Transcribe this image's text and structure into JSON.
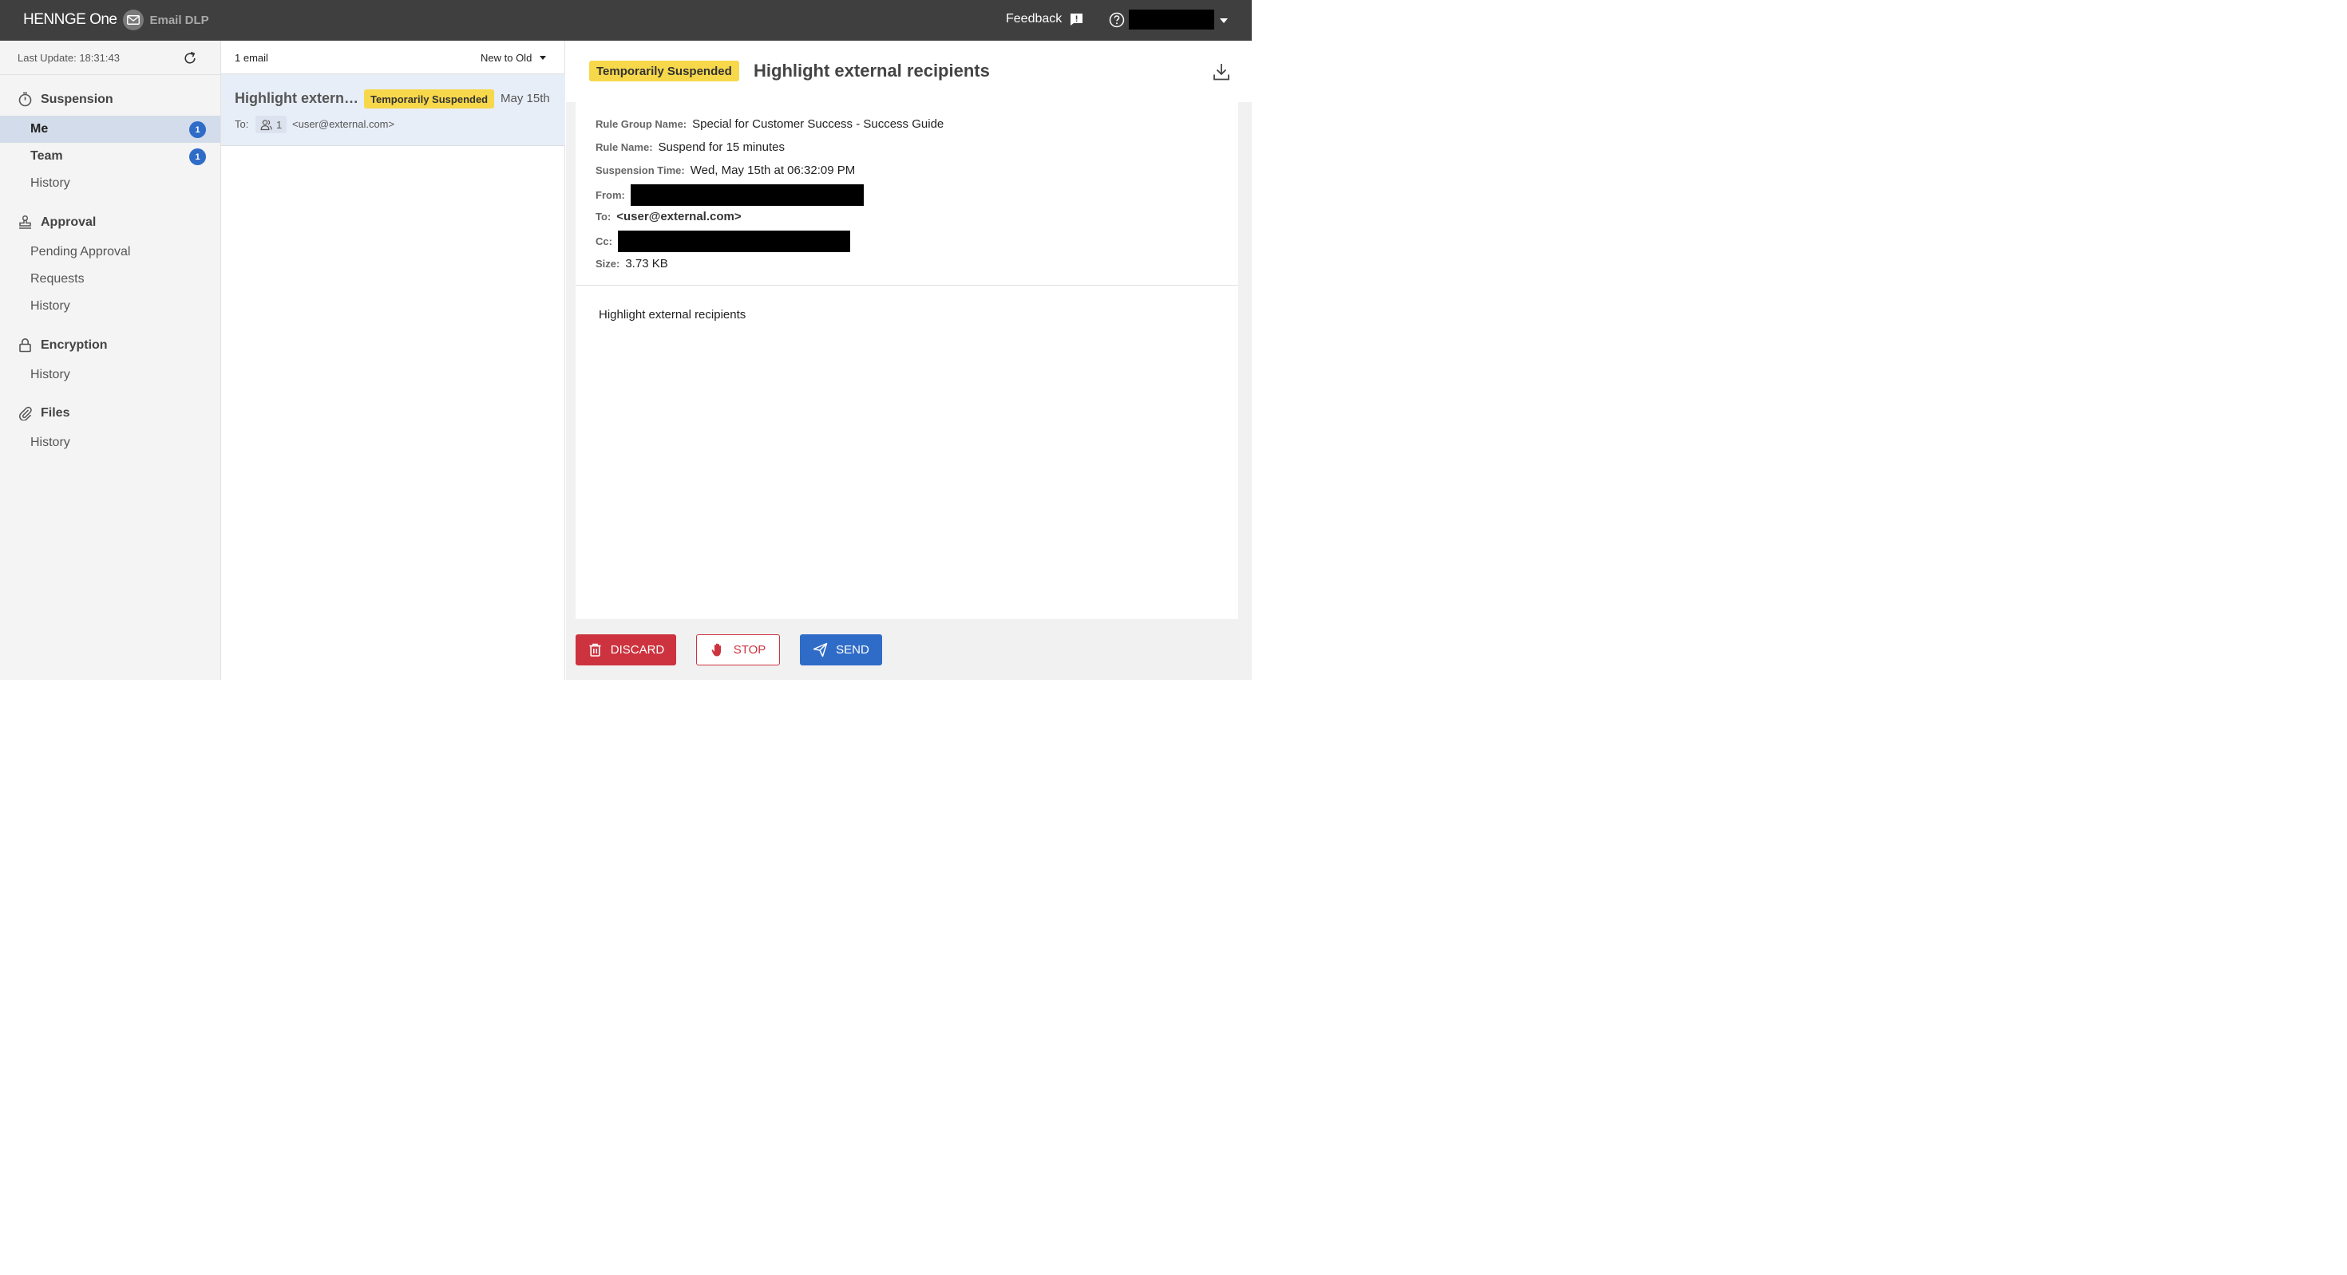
{
  "topbar": {
    "brand": "HENNGE One",
    "product": "Email DLP",
    "feedback_label": "Feedback"
  },
  "sidebar": {
    "last_update": "Last Update: 18:31:43",
    "sections": {
      "suspension": {
        "title": "Suspension",
        "me": {
          "label": "Me",
          "count": "1"
        },
        "team": {
          "label": "Team",
          "count": "1"
        },
        "history": "History"
      },
      "approval": {
        "title": "Approval",
        "pending": "Pending Approval",
        "requests": "Requests",
        "history": "History"
      },
      "encryption": {
        "title": "Encryption",
        "history": "History"
      },
      "files": {
        "title": "Files",
        "history": "History"
      }
    }
  },
  "list": {
    "count_label": "1 email",
    "sort_label": "New to Old",
    "emails": [
      {
        "subject": "Highlight external recipients",
        "status": "Temporarily Suspended",
        "date": "May 15th",
        "to_label": "To:",
        "recipient_count": "1",
        "to_address": "<user@external.com>"
      }
    ]
  },
  "detail": {
    "status": "Temporarily Suspended",
    "title": "Highlight external recipients",
    "meta": {
      "rule_group_label": "Rule Group Name:",
      "rule_group_value": "Special for Customer Success - Success Guide",
      "rule_name_label": "Rule Name:",
      "rule_name_value": "Suspend for 15 minutes",
      "suspension_time_label": "Suspension Time:",
      "suspension_time_value": "Wed, May 15th at 06:32:09 PM",
      "from_label": "From:",
      "to_label": "To:",
      "to_value": "<user@external.com>",
      "cc_label": "Cc:",
      "size_label": "Size:",
      "size_value": "3.73 KB"
    },
    "body": "Highlight external recipients"
  },
  "actions": {
    "discard": "DISCARD",
    "stop": "STOP",
    "send": "SEND"
  },
  "colors": {
    "topbar": "#3f3f3f",
    "accent_blue": "#2f6cc7",
    "danger_red": "#cd333f",
    "status_yellow": "#f7d84b",
    "active_nav": "#d3dcea"
  }
}
